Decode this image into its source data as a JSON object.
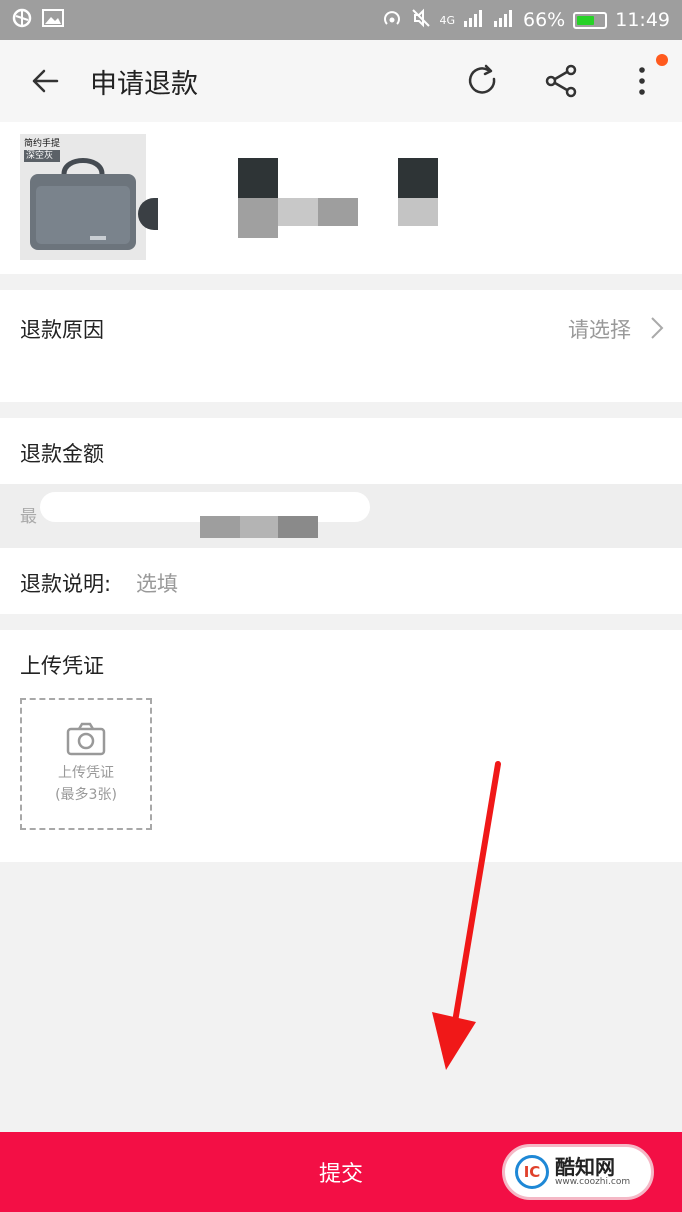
{
  "status_bar": {
    "battery_percent": "66%",
    "battery_level": 0.66,
    "network": "4G",
    "time": "11:49"
  },
  "header": {
    "title": "申请退款",
    "icons": [
      "back-arrow-icon",
      "refresh-icon",
      "share-icon",
      "more-vertical-icon"
    ],
    "badge_color": "#ff5a1e"
  },
  "product": {
    "image_tag_line1": "简约手提",
    "image_tag_line2": "深空灰"
  },
  "refund_reason": {
    "label": "退款原因",
    "value": "请选择"
  },
  "refund_amount": {
    "label": "退款金额",
    "hint_prefix": "最"
  },
  "refund_note": {
    "label": "退款说明:",
    "placeholder": "选填"
  },
  "upload": {
    "section_title": "上传凭证",
    "box_label": "上传凭证",
    "box_limit": "(最多3张)"
  },
  "submit": {
    "label": "提交",
    "color": "#f30f45"
  },
  "watermark": {
    "logo_text": "IC",
    "name": "酷知网",
    "url": "www.coozhi.com"
  }
}
